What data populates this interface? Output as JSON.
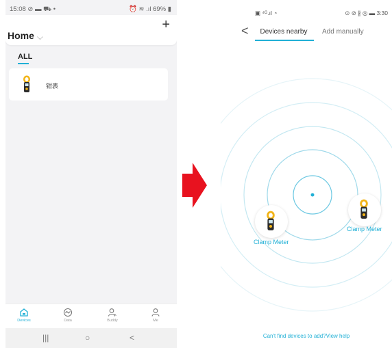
{
  "left_phone": {
    "status_time": "15:08 ⊘ ▬ ⛟ •",
    "status_right": "⏰ ≋ .ıl 69% ▮",
    "title": "Home",
    "title_chevron": "⌵",
    "plus_label": "+",
    "filter_label": "ALL",
    "device": {
      "name": "钳表",
      "icon": "clamp-meter"
    },
    "tabs": [
      {
        "label": "Devices",
        "icon": "home-icon",
        "active": true
      },
      {
        "label": "Data",
        "icon": "data-icon",
        "active": false
      },
      {
        "label": "Buddy",
        "icon": "buddy-icon",
        "active": false
      },
      {
        "label": "Me",
        "icon": "person-icon",
        "active": false
      }
    ],
    "nav": {
      "recents": "|||",
      "home": "○",
      "back": "<"
    }
  },
  "arrow": {
    "color": "#e8121f"
  },
  "right_phone": {
    "status_left": "▣ ⁴ᴳ.ıl ◔",
    "status_right": "⊙ ⊘ ∦ ◎ ▬ 3:30",
    "back": "<",
    "tab_nearby": "Devices nearby",
    "tab_manual": "Add manually",
    "devices": [
      {
        "label": "Clamp Meter"
      },
      {
        "label": "Clamp Meter"
      }
    ],
    "help_text": "Can't find devices to add?View help"
  },
  "accent_color": "#21b0d6"
}
